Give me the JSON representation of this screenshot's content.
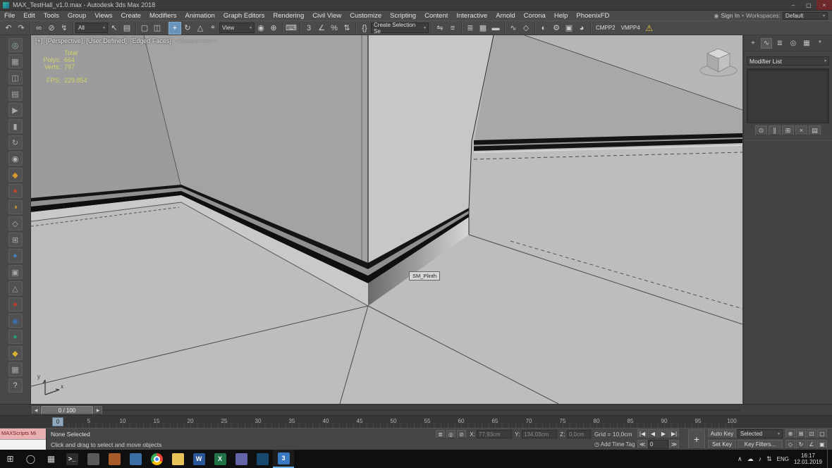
{
  "window": {
    "title": "MAX_TestHall_v1.0.max - Autodesk 3ds Max 2018",
    "minimize": "–",
    "restore": "▢",
    "close": "×"
  },
  "menu": {
    "items": [
      "File",
      "Edit",
      "Tools",
      "Group",
      "Views",
      "Create",
      "Modifiers",
      "Animation",
      "Graph Editors",
      "Rendering",
      "Civil View",
      "Customize",
      "Scripting",
      "Content",
      "Interactive",
      "Arnold",
      "Corona",
      "Help",
      "PhoenixFD"
    ]
  },
  "account": {
    "sign_in": "Sign In",
    "workspaces_label": "Workspaces:",
    "workspace": "Default"
  },
  "icons": {
    "caret": "▾",
    "person": "◉",
    "warning": "⚠",
    "clock": "◷",
    "start": "⊞",
    "search": "◯",
    "taskview": "▦",
    "tray_up": "∧",
    "cloud": "☁",
    "sound": "♪",
    "net": "⇅",
    "prev": "◀",
    "next": "▶"
  },
  "toolbar": {
    "selection_filter": "All",
    "coord_system": "View",
    "named_sets": "Create Selection Se",
    "cmpp2": "CMPP2",
    "vmpp4": "VMPP4",
    "icons": [
      {
        "name": "undo",
        "g": "↶"
      },
      {
        "name": "redo",
        "g": "↷"
      },
      {
        "name": "select-and-link",
        "g": "∞"
      },
      {
        "name": "unlink-selection",
        "g": "⊘"
      },
      {
        "name": "bind-to-space-warp",
        "g": "↯"
      },
      {
        "name": "select-object",
        "g": "↖"
      },
      {
        "name": "select-by-name",
        "g": "▤"
      },
      {
        "name": "rectangular-selection-region",
        "g": "▢"
      },
      {
        "name": "window-crossing-toggle",
        "g": "◫"
      },
      {
        "name": "select-and-move",
        "g": "+"
      },
      {
        "name": "select-and-rotate",
        "g": "↻"
      },
      {
        "name": "select-and-scale",
        "g": "△"
      },
      {
        "name": "select-and-place",
        "g": "⌖"
      },
      {
        "name": "use-pivot-point-center",
        "g": "◉"
      },
      {
        "name": "select-and-manipulate",
        "g": "⊕"
      },
      {
        "name": "keyboard-shortcut-override",
        "g": "⌨"
      },
      {
        "name": "snaps-toggle",
        "g": "3"
      },
      {
        "name": "angle-snap",
        "g": "∠"
      },
      {
        "name": "percent-snap",
        "g": "%"
      },
      {
        "name": "spinner-snap",
        "g": "⇅"
      },
      {
        "name": "edit-named-selection-sets",
        "g": "{}"
      },
      {
        "name": "mirror",
        "g": "⇋"
      },
      {
        "name": "align",
        "g": "≡"
      },
      {
        "name": "toggle-scene-explorer",
        "g": "≣"
      },
      {
        "name": "toggle-layer-explorer",
        "g": "▦"
      },
      {
        "name": "toggle-ribbon",
        "g": "▬"
      },
      {
        "name": "curve-editor",
        "g": "∿"
      },
      {
        "name": "schematic-view",
        "g": "◇"
      },
      {
        "name": "material-editor",
        "g": "◐"
      },
      {
        "name": "render-setup",
        "g": "⚙"
      },
      {
        "name": "rendered-frame-window",
        "g": "▣"
      },
      {
        "name": "render-production",
        "g": "◕"
      }
    ]
  },
  "left_toolbar": {
    "icons": [
      {
        "g": "◎",
        "c": "#8fb7a6"
      },
      {
        "g": "▦",
        "c": "#a8a8a8"
      },
      {
        "g": "◫",
        "c": "#a8a8a8"
      },
      {
        "g": "▤",
        "c": "#a8a8a8"
      },
      {
        "g": "▶",
        "c": "#a8a8a8"
      },
      {
        "g": "▮",
        "c": "#a8a8a8"
      },
      {
        "g": "↻",
        "c": "#a8a8a8"
      },
      {
        "g": "◉",
        "c": "#b8b8b8"
      },
      {
        "g": "◆",
        "c": "#d79a2f"
      },
      {
        "g": "●",
        "c": "#c2482a"
      },
      {
        "g": "◑",
        "c": "#d79a2f"
      },
      {
        "g": "◇",
        "c": "#b0b0b0"
      },
      {
        "g": "⊞",
        "c": "#a8a8a8"
      },
      {
        "g": "●",
        "c": "#4a7fb5"
      },
      {
        "g": "▣",
        "c": "#a8a8a8"
      },
      {
        "g": "△",
        "c": "#a8a8a8"
      },
      {
        "g": "●",
        "c": "#c03a2a"
      },
      {
        "g": "◉",
        "c": "#3a6fb0"
      },
      {
        "g": "●",
        "c": "#2f9a7a"
      },
      {
        "g": "◆",
        "c": "#d7b12f"
      },
      {
        "g": "▦",
        "c": "#a8a8a8"
      },
      {
        "g": "?",
        "c": "#cccccc"
      }
    ]
  },
  "viewport": {
    "label_plus": "[+]",
    "label_pov": "[Perspective]",
    "label_user": "[User Defined]",
    "label_shading": "[Edged Faces]",
    "label_suffix": "<Stdselection>",
    "stats": {
      "total": "Total",
      "polys_label": "Polys:",
      "polys_value": "664",
      "verts_label": "Verts:",
      "verts_value": "797",
      "fps_label": "FPS:",
      "fps_value": "229.854"
    },
    "tooltip": "SM_Plinth",
    "axis_x": "x",
    "axis_y": "y"
  },
  "command_panel": {
    "tabs": [
      {
        "name": "tab-create",
        "g": "+"
      },
      {
        "name": "tab-modify",
        "g": "∿"
      },
      {
        "name": "tab-hierarchy",
        "g": "≣"
      },
      {
        "name": "tab-motion",
        "g": "◎"
      },
      {
        "name": "tab-display",
        "g": "▦"
      },
      {
        "name": "tab-utilities",
        "g": "*"
      }
    ],
    "modifier_list_label": "Modifier List",
    "stack_buttons": [
      {
        "name": "pin-stack",
        "g": "⊙"
      },
      {
        "name": "show-end-result",
        "g": "∥"
      },
      {
        "name": "make-unique",
        "g": "⊞"
      },
      {
        "name": "remove-modifier",
        "g": "×"
      },
      {
        "name": "configure-modifier-sets",
        "g": "▤"
      }
    ]
  },
  "timeline": {
    "slider_value": "0 / 100",
    "marker": "0",
    "ticks": [
      "0",
      "5",
      "10",
      "15",
      "20",
      "25",
      "30",
      "35",
      "40",
      "45",
      "50",
      "55",
      "60",
      "65",
      "70",
      "75",
      "80",
      "85",
      "90",
      "95",
      "100"
    ]
  },
  "status": {
    "maxscript_text": "MAXScripts Mi",
    "selection_status": "None Selected",
    "prompt": "Click and drag to select and move objects",
    "mini_icons": [
      {
        "name": "status-bar-options",
        "g": "≣"
      },
      {
        "name": "isolate-selection-toggle",
        "g": "◎"
      },
      {
        "name": "selection-lock-toggle",
        "g": "⊘"
      }
    ],
    "x_label": "X:",
    "x_value": "77,93cm",
    "y_label": "Y:",
    "y_value": "134,03cm",
    "z_label": "Z:",
    "z_value": "0,0cm",
    "grid": "Grid = 10,0cm",
    "add_time_tag": "Add Time Tag",
    "playback": {
      "go_start": "|◀",
      "prev": "◀",
      "play": "▶",
      "go_end": "▶|",
      "back": "≪",
      "frame": "0",
      "fwd": "≫"
    },
    "set_keys_glyph": "+",
    "nav": [
      {
        "name": "zoom",
        "g": "⊕"
      },
      {
        "name": "zoom-all",
        "g": "⊞"
      },
      {
        "name": "zoom-extents",
        "g": "⊡"
      },
      {
        "name": "zoom-region",
        "g": "▢"
      },
      {
        "name": "pan-view",
        "g": "◇"
      },
      {
        "name": "orbit",
        "g": "↻"
      },
      {
        "name": "fov",
        "g": "∠"
      },
      {
        "name": "maximize-viewport-toggle",
        "g": "▣"
      }
    ]
  },
  "animation": {
    "auto_key": "Auto Key",
    "set_key": "Set Key",
    "key_mode": "Selected",
    "key_filters": "Key Filters..."
  },
  "taskbar": {
    "time": "16:17",
    "date": "12.01.2019",
    "lang": "ENG",
    "apps": [
      {
        "name": "taskbar-app-terminal",
        "c": "#2d2d2d",
        "g": ">_"
      },
      {
        "name": "taskbar-app-2",
        "c": "#5a5a5a",
        "g": ""
      },
      {
        "name": "taskbar-app-3",
        "c": "#a85b2a",
        "g": ""
      },
      {
        "name": "taskbar-app-4",
        "c": "#3a6ea5",
        "g": ""
      },
      {
        "name": "taskbar-app-chrome",
        "c": "#4285f4",
        "g": ""
      },
      {
        "name": "taskbar-app-file-explorer",
        "c": "#e8c35a",
        "g": ""
      },
      {
        "name": "taskbar-app-word",
        "c": "#2b579a",
        "g": "W"
      },
      {
        "name": "taskbar-app-excel",
        "c": "#217346",
        "g": "X"
      },
      {
        "name": "taskbar-app-9",
        "c": "#6264a7",
        "g": ""
      },
      {
        "name": "taskbar-app-10",
        "c": "#174a6e",
        "g": ""
      },
      {
        "name": "taskbar-app-3dsmax",
        "c": "#3a78c2",
        "g": "3"
      }
    ]
  }
}
